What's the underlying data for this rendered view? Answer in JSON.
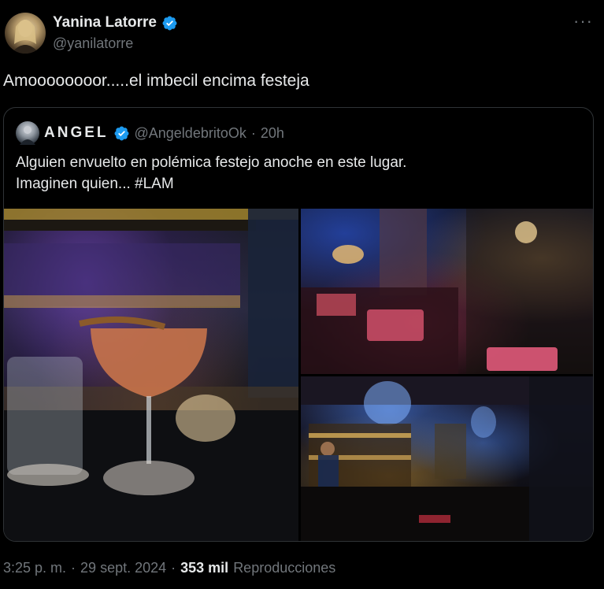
{
  "tweet": {
    "author": {
      "display_name": "Yanina Latorre",
      "handle": "@yanilatorre",
      "verified": true
    },
    "more_icon": "more-icon",
    "text": "Amoooooooor.....el imbecil encima festeja",
    "meta": {
      "time": "3:25 p. m.",
      "separator": "·",
      "date": "29 sept. 2024",
      "separator2": "·",
      "views": "353 mil",
      "views_label": "Reproducciones"
    }
  },
  "quote": {
    "author": {
      "display_name": "ANGEL",
      "handle": "@AngeldebritoOk",
      "separator": "·",
      "time": "20h",
      "verified": true
    },
    "text_lines": [
      "Alguien envuelto en polémica festejo anoche en este lugar.",
      "Imaginen quien... #LAM"
    ],
    "media": [
      "cocktail-photo",
      "lounge-photo",
      "bar-photo"
    ]
  },
  "colors": {
    "background": "#000000",
    "text": "#e7e9ea",
    "secondary": "#71767b",
    "verified": "#1d9bf0",
    "border": "#2f3336"
  }
}
